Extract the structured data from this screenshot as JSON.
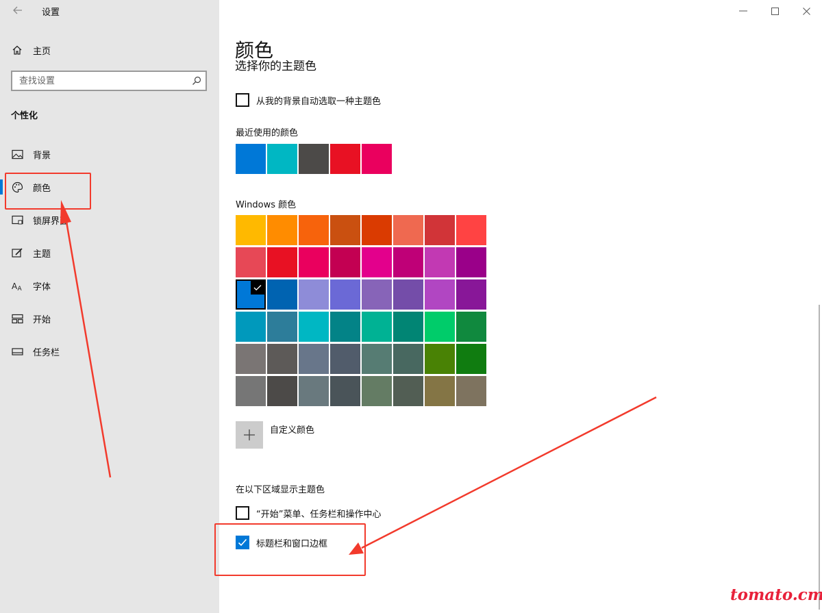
{
  "window": {
    "title": "设置",
    "back_icon": "arrow-left-icon",
    "controls": [
      "minimize",
      "maximize",
      "close"
    ]
  },
  "sidebar": {
    "home": {
      "label": "主页",
      "icon": "home-icon"
    },
    "search": {
      "placeholder": "查找设置",
      "icon": "search-icon"
    },
    "section_title": "个性化",
    "items": [
      {
        "label": "背景",
        "icon": "picture-icon"
      },
      {
        "label": "颜色",
        "icon": "palette-icon",
        "active": true
      },
      {
        "label": "锁屏界面",
        "icon": "lock-screen-icon"
      },
      {
        "label": "主题",
        "icon": "brush-icon"
      },
      {
        "label": "字体",
        "icon": "font-icon"
      },
      {
        "label": "开始",
        "icon": "start-icon"
      },
      {
        "label": "任务栏",
        "icon": "taskbar-icon"
      }
    ]
  },
  "main": {
    "page_title": "颜色",
    "partial_heading": "选择你的主题色",
    "auto_pick_label": "从我的背景自动选取一种主题色",
    "auto_pick_checked": false,
    "recent_label": "最近使用的颜色",
    "recent_colors": [
      "#0078d7",
      "#00b7c3",
      "#4c4a48",
      "#e81123",
      "#ea005e"
    ],
    "windows_colors_label": "Windows 颜色",
    "selected_color": "#0078d7",
    "windows_colors": [
      [
        "#ffb900",
        "#ff8c00",
        "#f7630c",
        "#ca5010",
        "#da3b01",
        "#ef6950",
        "#d13438",
        "#ff4343"
      ],
      [
        "#e74856",
        "#e81123",
        "#ea005e",
        "#c30052",
        "#e3008c",
        "#bf0077",
        "#c239b3",
        "#9a0089"
      ],
      [
        "#0078d7",
        "#0063b1",
        "#8e8cd8",
        "#6b69d6",
        "#8764b8",
        "#744da9",
        "#b146c2",
        "#881798"
      ],
      [
        "#0099bc",
        "#2d7d9a",
        "#00b7c3",
        "#038387",
        "#00b294",
        "#018574",
        "#00cc6a",
        "#10893e"
      ],
      [
        "#7a7574",
        "#5d5a58",
        "#68768a",
        "#515c6b",
        "#567c73",
        "#486860",
        "#498205",
        "#107c10"
      ],
      [
        "#767676",
        "#4c4a48",
        "#69797e",
        "#4a5459",
        "#647c64",
        "#525e54",
        "#847545",
        "#7e735f"
      ]
    ],
    "custom_color_label": "自定义颜色",
    "show_accent_label": "在以下区域显示主题色",
    "surfaces": [
      {
        "label": "“开始”菜单、任务栏和操作中心",
        "checked": false
      },
      {
        "label": "标题栏和窗口边框",
        "checked": true
      }
    ]
  },
  "watermark": "tomato.cm",
  "colors": {
    "accent": "#0078d7",
    "annotation": "#f23a2c",
    "sidebar_bg": "#e6e6e6"
  }
}
